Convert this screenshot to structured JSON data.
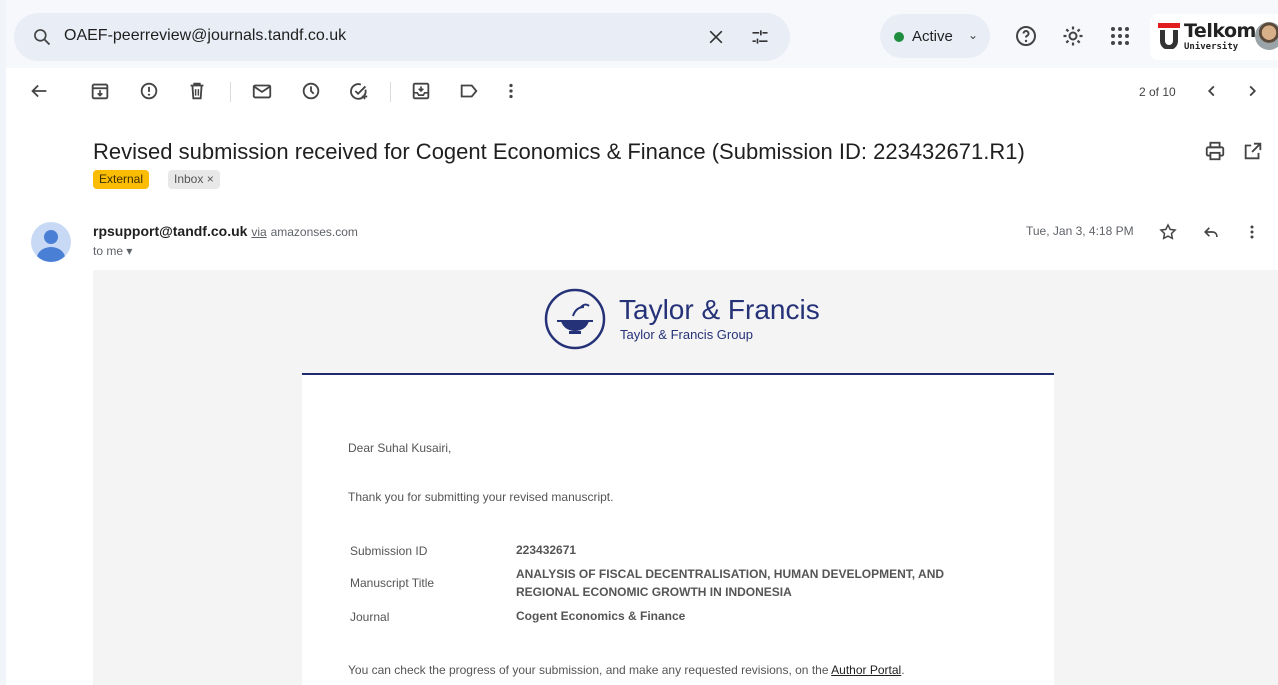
{
  "search": {
    "query": "OAEF-peerreview@journals.tandf.co.uk"
  },
  "status": {
    "label": "Active"
  },
  "brand": {
    "name": "Telkom",
    "sub": "University"
  },
  "toolbar": {
    "counter": "2 of 10"
  },
  "email": {
    "subject": "Revised submission received for Cogent Economics & Finance (Submission ID: 223432671.R1)",
    "labels": {
      "external": "External",
      "inbox": "Inbox ×"
    },
    "sender": {
      "address": "rpsupport@tandf.co.uk",
      "via": "via",
      "domain": "amazonses.com"
    },
    "to": "to me ▾",
    "date": "Tue, Jan 3, 4:18 PM"
  },
  "body": {
    "logo_name": "Taylor & Francis",
    "logo_sub": "Taylor & Francis Group",
    "greeting": "Dear Suhal Kusairi,",
    "thanks": "Thank you for submitting your revised manuscript.",
    "details": [
      {
        "label": "Submission ID",
        "value": "223432671"
      },
      {
        "label": "Manuscript Title",
        "value": "ANALYSIS OF FISCAL DECENTRALISATION, HUMAN DEVELOPMENT, AND REGIONAL ECONOMIC GROWTH IN INDONESIA"
      },
      {
        "label": "Journal",
        "value": "Cogent Economics & Finance"
      }
    ],
    "progress_text": "You can check the progress of your submission, and make any requested revisions, on the ",
    "portal_link": "Author Portal",
    "progress_end": "."
  },
  "colors": {
    "accent": "#253278",
    "external_tag": "#fbbc04",
    "active": "#1e8e3e"
  }
}
